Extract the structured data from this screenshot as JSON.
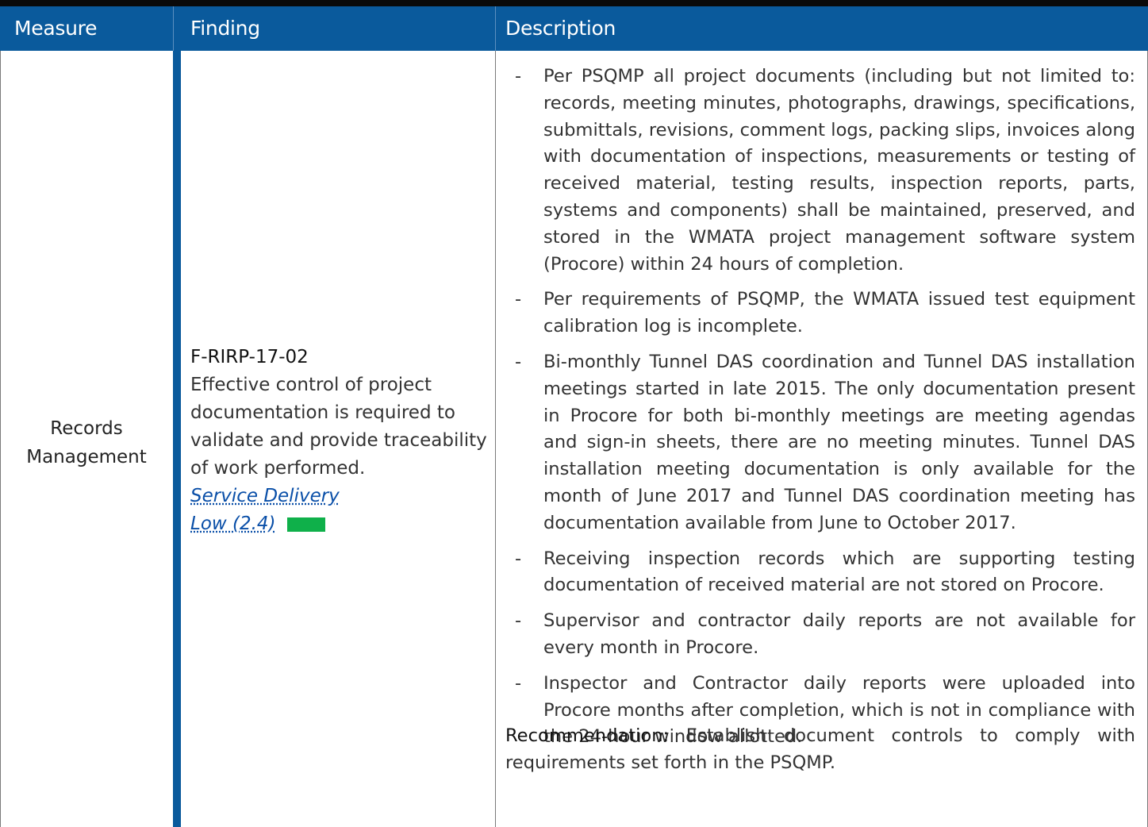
{
  "header": {
    "col_measure": "Measure",
    "col_finding": "Finding",
    "col_description": "Description"
  },
  "row": {
    "measure": "Records Management",
    "finding": {
      "id": "F-RIRP-17-02",
      "text": "Effective control of project documentation is required to validate and provide traceability of work performed.",
      "category_link": "Service Delivery",
      "risk_link": "Low (2.4)",
      "risk_color": "#0fb04a"
    },
    "description": {
      "items": [
        "Per PSQMP all project documents (including but not limited to: records, meeting minutes, photographs, drawings, specifications, submittals, revisions, comment logs, packing slips, invoices along with documentation of inspections, measurements or testing of received material, testing results, inspection reports, parts, systems and components) shall be maintained, preserved, and stored in the WMATA project management software system (Procore) within 24 hours of completion.",
        "Per requirements of PSQMP, the WMATA issued test equipment calibration log is incomplete.",
        "Bi-monthly Tunnel DAS coordination and Tunnel DAS installation meetings started in late 2015. The only documentation present in Procore for both bi-monthly meetings are meeting agendas and sign-in sheets, there are no meeting minutes. Tunnel DAS installation meeting documentation is only available for the month of June 2017 and Tunnel DAS coordination meeting has documentation available from June to October 2017.",
        "Receiving inspection records which are supporting testing documentation of received material are not stored on Procore.",
        "Supervisor and contractor daily reports are not available for every month in Procore.",
        "Inspector and Contractor daily reports were uploaded into Procore months after completion, which is not in compliance with the 24-hour window allotted."
      ],
      "dash": "-",
      "recommendation_label": "Recommendation:",
      "recommendation_text": "Establish document controls to comply with requirements set forth in the PSQMP."
    }
  }
}
